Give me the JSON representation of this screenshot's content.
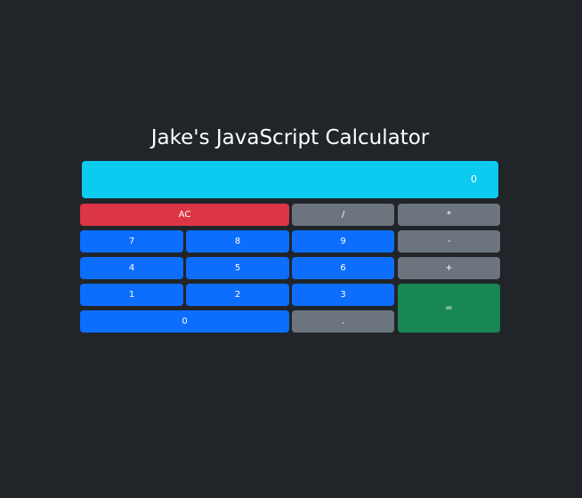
{
  "page": {
    "title": "Jake's JavaScript Calculator"
  },
  "display": {
    "value": "0"
  },
  "buttons": {
    "clear": "AC",
    "divide": "/",
    "multiply": "*",
    "subtract": "-",
    "add": "+",
    "equals": "=",
    "decimal": ".",
    "seven": "7",
    "eight": "8",
    "nine": "9",
    "four": "4",
    "five": "5",
    "six": "6",
    "one": "1",
    "two": "2",
    "three": "3",
    "zero": "0"
  },
  "colors": {
    "background": "#212529",
    "display": "#0dcaf0",
    "number": "#0d6efd",
    "operator": "#6c757d",
    "clear": "#dc3545",
    "equals": "#198754"
  }
}
